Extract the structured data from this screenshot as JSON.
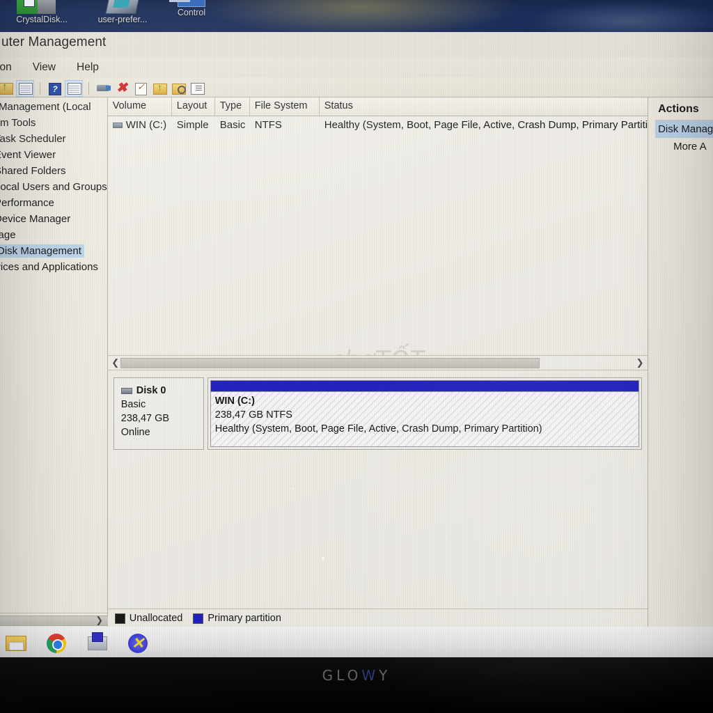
{
  "desktop": {
    "icons": [
      {
        "label": "CrystalDisk...",
        "icon": "crystaldiskinfo-icon"
      },
      {
        "label": "user-prefer...",
        "icon": "user-preferences-icon"
      },
      {
        "label": "Control",
        "icon": "control-panel-icon"
      }
    ]
  },
  "window": {
    "title": "uter Management",
    "menu": [
      "ion",
      "View",
      "Help"
    ],
    "toolbar_icons": [
      "back-folder-icon",
      "show-hide-tree-icon",
      "help-icon",
      "properties-pane-icon",
      "connect-icon",
      "delete-icon",
      "task-icon",
      "export-folder-icon",
      "search-icon",
      "list-view-icon"
    ]
  },
  "tree": {
    "items": [
      {
        "label": "uter Management (Local",
        "icon": "computer-icon",
        "level": 0,
        "selected": false
      },
      {
        "label": "stem Tools",
        "icon": "system-tools-icon",
        "level": 1,
        "selected": false
      },
      {
        "label": "Task Scheduler",
        "icon": "clock-icon",
        "level": 2,
        "selected": false
      },
      {
        "label": "Event Viewer",
        "icon": "event-viewer-icon",
        "level": 2,
        "selected": false
      },
      {
        "label": "Shared Folders",
        "icon": "shared-folder-icon",
        "level": 2,
        "selected": false
      },
      {
        "label": "Local Users and Groups",
        "icon": "users-icon",
        "level": 2,
        "selected": false
      },
      {
        "label": "Performance",
        "icon": "performance-icon",
        "level": 2,
        "selected": false
      },
      {
        "label": "Device Manager",
        "icon": "device-manager-icon",
        "level": 2,
        "selected": false
      },
      {
        "label": "torage",
        "icon": "storage-icon",
        "level": 1,
        "selected": false
      },
      {
        "label": "Disk Management",
        "icon": "disk-management-icon",
        "level": 2,
        "selected": true
      },
      {
        "label": "ervices and Applications",
        "icon": "services-icon",
        "level": 1,
        "selected": false
      }
    ]
  },
  "volume_list": {
    "columns": [
      "Volume",
      "Layout",
      "Type",
      "File System",
      "Status"
    ],
    "rows": [
      {
        "volume": "WIN (C:)",
        "layout": "Simple",
        "type": "Basic",
        "file_system": "NTFS",
        "status": "Healthy (System, Boot, Page File, Active, Crash Dump, Primary Partiti"
      }
    ],
    "watermark": "chợTỐT"
  },
  "disk_graphic": {
    "disks": [
      {
        "name": "Disk 0",
        "disk_type": "Basic",
        "capacity": "238,47 GB",
        "state": "Online",
        "partitions": [
          {
            "name": "WIN  (C:)",
            "size": "238,47 GB NTFS",
            "status": "Healthy (System, Boot, Page File, Active, Crash Dump, Primary Partition)",
            "bar_color": "#1d1dc4"
          }
        ]
      }
    ]
  },
  "legend": {
    "items": [
      {
        "label": "Unallocated",
        "color": "#141414"
      },
      {
        "label": "Primary partition",
        "color": "#1d1dc4"
      }
    ]
  },
  "actions": {
    "title": "Actions",
    "items": [
      {
        "label": "Disk Manag",
        "selected": true
      },
      {
        "label": "More A",
        "selected": false
      }
    ]
  },
  "taskbar": {
    "icons": [
      "file-explorer-icon",
      "google-chrome-icon",
      "printer-icon",
      "vlc-x-icon"
    ]
  },
  "bezel": {
    "brand_left": "GLO",
    "brand_w": "W",
    "brand_right": "Y"
  }
}
